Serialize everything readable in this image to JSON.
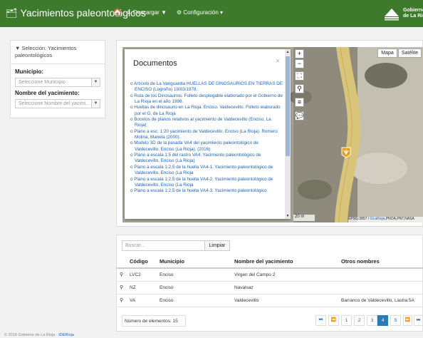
{
  "topbar": {
    "title": "Yacimientos paleontológicos",
    "download_label": "Descargar",
    "config_label": "Configuración",
    "gov_line1": "Gobierno",
    "gov_line2": "de La Rioja"
  },
  "sidebar": {
    "selection_label": "Selección: Yacimientos paleontológicos",
    "municipio_label": "Municipio:",
    "municipio_placeholder": "Seleccione Municipio",
    "yacimiento_label": "Nombre del yacimiento:",
    "yacimiento_placeholder": "Seleccione Nombre del yacimi..."
  },
  "map": {
    "type_map": "Mapa",
    "type_satellite": "Satélite",
    "scale": "20 m",
    "attribution_prefix": "EPSG:3857 / ",
    "attribution_link": "GLaRioja",
    "attribution_suffix": ",PNOA,PNT,NASA"
  },
  "documents": {
    "title": "Documentos",
    "close": "×",
    "items": [
      "Artículo de La Vanguardia HUELLAS DE DINOSAURIOS EN TIERRAS DE ENCISO (Logroño) 19/03/1978.",
      "Ruta de los Dinosaurios. Folleto desplegable elaborado por el Gobierno de La Rioja en el año 1998.",
      "Huellas de dinosaurio en La Rioja. Enciso. Valdecevillo. Folleto elaborado por el G. de La Rioja",
      "Bocetos de planos relativos al yacimiento de Valdecevillo (Enciso, La Rioja)",
      "Plano a esc. 1:20 yacimiento de Valdecevillo, Enciso (La Rioja). Romero Molina, Mariela (2000).",
      "Modelo 3D de la pasada VA4 del yacimiento paleontológico de Valdecevillo, Enciso (La Rioja). (2016)",
      "Plano a escala 1:5 del rastro VA4. Yacimiento paleontológico de Valdecevillo, Enciso (La Rioja)",
      "Plano a escala 1:2,5 de la huella VA4-1. Yacimiento paleontológico de Valdecevillo, Enciso (La Rioja",
      "Plano a escala 1:2,5 de la huella VA4-2. Yacimiento paleontológico de Valdecevillo, Enciso (La Rioja",
      "Plano a escala 1:2,5 de la huella VA4-3. Yacimiento paleontológico"
    ]
  },
  "table": {
    "search_placeholder": "Buscar...",
    "clear_label": "Limpiar",
    "headers": [
      "Código",
      "Municipio",
      "Nombre del yacimiento",
      "Otros nombres"
    ],
    "rows": [
      [
        "LVC2",
        "Enciso",
        "Virgen del Campo 2",
        ""
      ],
      [
        "NZ",
        "Enciso",
        "Navalsaz",
        ""
      ],
      [
        "VA",
        "Enciso",
        "Valdecevillo",
        "Barranco de Valdecevillo, Lastra 5A"
      ]
    ],
    "count_label": "Número de elementos: 15",
    "pages": [
      "1",
      "2",
      "3",
      "4",
      "5"
    ],
    "active_page": "4"
  },
  "footer": {
    "copyright": "© 2018 Gobierno de La Rioja ·",
    "link": "IDERioja"
  }
}
